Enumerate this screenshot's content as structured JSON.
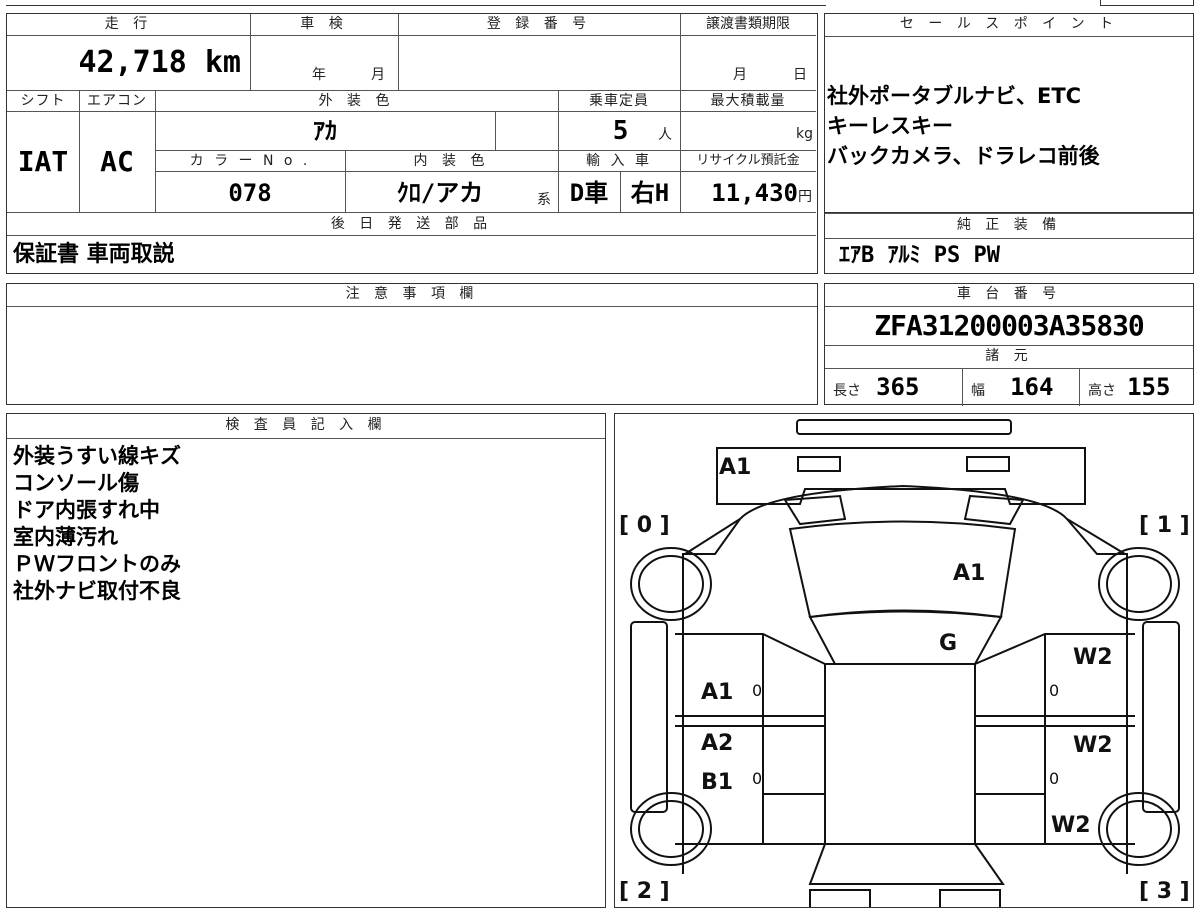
{
  "top": {
    "mileage_label": "走 行",
    "mileage_value": "42,718",
    "mileage_unit": "km",
    "inspection_label": "車 検",
    "inspection_year": "年",
    "inspection_month": "月",
    "registration_label": "登 録 番 号",
    "transfer_label": "譲渡書類期限",
    "transfer_month": "月",
    "transfer_day": "日",
    "shift_label": "シフト",
    "aircon_label": "エアコン",
    "exterior_color_label": "外 装 色",
    "capacity_label": "乗車定員",
    "maxload_label": "最大積載量",
    "shift_value": "IAT",
    "aircon_value": "AC",
    "exterior_color_value": "ｱｶ",
    "capacity_value": "5",
    "capacity_unit": "人",
    "maxload_unit": "kg",
    "color_no_label": "カ ラ ー N o .",
    "interior_color_label": "内 装 色",
    "import_label": "輸 入 車",
    "recycle_label": "リサイクル預託金",
    "color_no_value": "078",
    "interior_color_value": "ｸﾛ/アカ",
    "interior_suffix": "系",
    "import_value_1": "D車",
    "import_value_2": "右H",
    "recycle_value": "11,430",
    "recycle_unit": "円",
    "later_parts_label": "後 日 発 送 部 品",
    "later_parts_value": "保証書 車両取説"
  },
  "sales_points": {
    "label": "セ ー ル ス ポ イ ン ト",
    "lines": [
      "社外ポータブルナビ、ETC",
      "キーレスキー",
      "バックカメラ、ドラレコ前後"
    ]
  },
  "genuine_equipment": {
    "label": "純 正 装 備",
    "value": "ｴｱB ｱﾙﾐ PS PW"
  },
  "notes": {
    "label": "注 意 事 項 欄"
  },
  "chassis": {
    "label": "車 台 番 号",
    "value": "ZFA31200003A35830"
  },
  "specs": {
    "label": "諸 元",
    "length_label": "長さ",
    "length_value": "365",
    "width_label": "幅",
    "width_value": "164",
    "height_label": "高さ",
    "height_value": "155"
  },
  "inspector": {
    "label": "検 査 員 記 入 欄",
    "lines": [
      "外装うすい線キズ",
      "コンソール傷",
      "ドア内張すれ中",
      "室内薄汚れ",
      "ＰＷフロントのみ",
      "社外ナビ取付不良"
    ]
  },
  "diagram": {
    "tire_fl": "[ 0 ]",
    "tire_fr": "[ 1 ]",
    "tire_rl": "[ 2 ]",
    "tire_rr": "[ 3 ]",
    "marks": {
      "front_bumper": "A1",
      "windshield": "A1",
      "roof": "G",
      "left_front_door": "A1",
      "left_rear_door_1": "A2",
      "left_rear_door_2": "B1",
      "right_front_door": "W2",
      "right_rear_door": "W2",
      "right_rear_fender": "W2",
      "zero_1": "0",
      "zero_2": "0",
      "zero_3": "0",
      "zero_4": "0"
    }
  }
}
